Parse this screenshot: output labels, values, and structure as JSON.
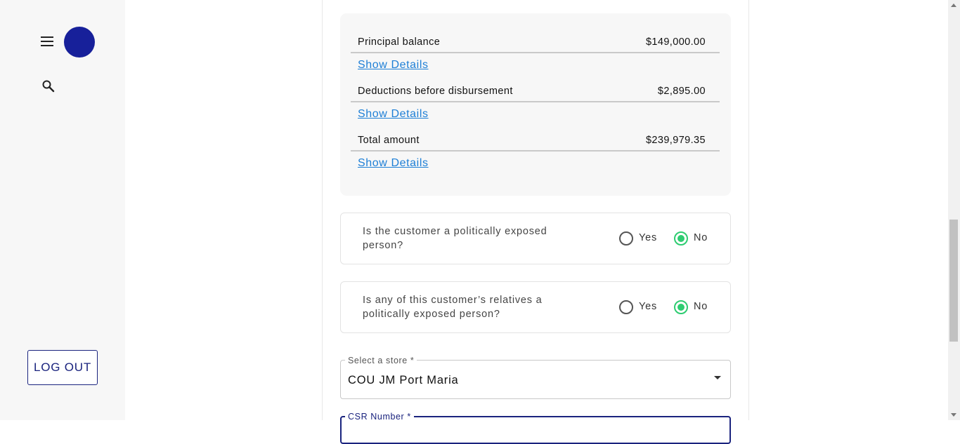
{
  "sidebar": {
    "logout_label": "LOG OUT"
  },
  "summary": {
    "rows": [
      {
        "label": "Principal balance",
        "value": "$149,000.00",
        "details": "Show Details"
      },
      {
        "label": "Deductions before disbursement",
        "value": "$2,895.00",
        "details": "Show Details"
      },
      {
        "label": "Total amount",
        "value": "$239,979.35",
        "details": "Show Details"
      }
    ]
  },
  "questions": [
    {
      "text": "Is the customer a politically exposed person?",
      "yes": "Yes",
      "no": "No",
      "selected": "No"
    },
    {
      "text": "Is any of this customer’s relatives a politically exposed person?",
      "yes": "Yes",
      "no": "No",
      "selected": "No"
    }
  ],
  "store_select": {
    "label": "Select a store *",
    "value": "COU JM Port Maria"
  },
  "csr_field": {
    "label": "CSR Number *"
  },
  "colors": {
    "brand": "#1a237e",
    "avatar": "#17209a",
    "link": "#1e7fd6",
    "radio_selected": "#2ecc71"
  }
}
